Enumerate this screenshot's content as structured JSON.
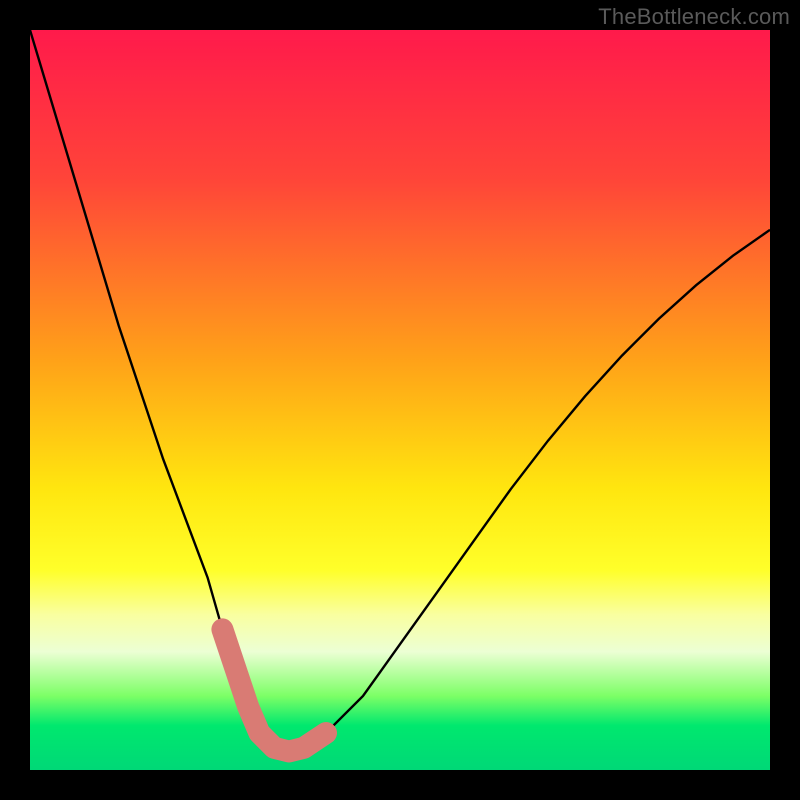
{
  "watermark": "TheBottleneck.com",
  "chart_data": {
    "type": "line",
    "title": "",
    "xlabel": "",
    "ylabel": "",
    "xlim": [
      0,
      100
    ],
    "ylim": [
      0,
      100
    ],
    "gradient_stops": [
      {
        "offset": 0,
        "color": "#ff1a4b"
      },
      {
        "offset": 20,
        "color": "#ff4439"
      },
      {
        "offset": 45,
        "color": "#ffa318"
      },
      {
        "offset": 62,
        "color": "#ffe60f"
      },
      {
        "offset": 73,
        "color": "#ffff2a"
      },
      {
        "offset": 79,
        "color": "#f9ffa0"
      },
      {
        "offset": 84,
        "color": "#ecffd4"
      },
      {
        "offset": 90,
        "color": "#7cff66"
      },
      {
        "offset": 94,
        "color": "#00e86e"
      },
      {
        "offset": 100,
        "color": "#00d877"
      }
    ],
    "series": [
      {
        "name": "bottleneck-curve",
        "x": [
          0,
          3,
          6,
          9,
          12,
          15,
          18,
          21,
          24,
          26,
          28,
          29.5,
          31,
          33,
          35,
          37,
          40,
          45,
          50,
          55,
          60,
          65,
          70,
          75,
          80,
          85,
          90,
          95,
          100
        ],
        "y": [
          100,
          90,
          80,
          70,
          60,
          51,
          42,
          34,
          26,
          19,
          13,
          8.5,
          5,
          3,
          2.5,
          3,
          5,
          10,
          17,
          24,
          31,
          38,
          44.5,
          50.5,
          56,
          61,
          65.5,
          69.5,
          73
        ]
      }
    ],
    "marker_segment": {
      "name": "optimum-range",
      "color": "#d97b74",
      "x": [
        26,
        28,
        29.5,
        31,
        33,
        35,
        37,
        40
      ],
      "y": [
        19,
        13,
        8.5,
        5,
        3,
        2.5,
        3,
        5
      ]
    }
  }
}
